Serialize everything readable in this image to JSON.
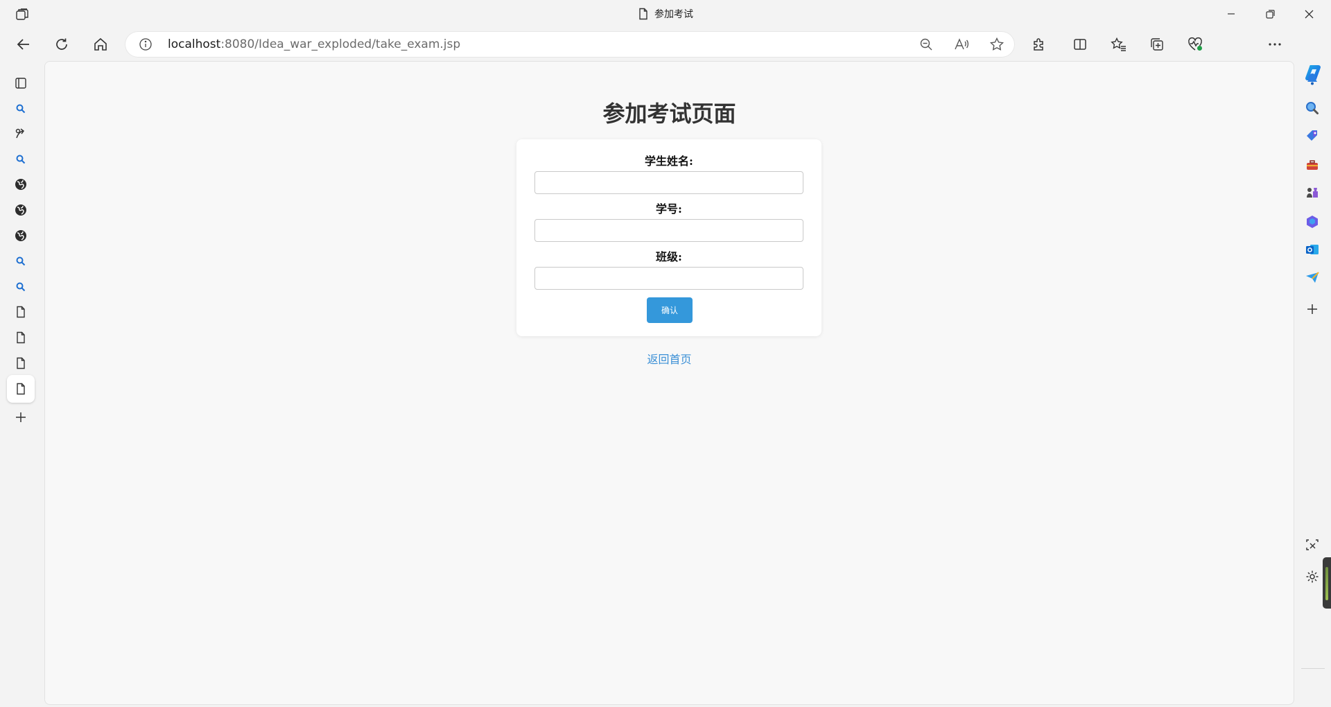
{
  "browser": {
    "tab_title": "参加考试",
    "url_host": "localhost",
    "url_rest": ":8080/Idea_war_exploded/take_exam.jsp",
    "icons": {
      "titlebar": [
        "tab-actions-icon",
        "page-icon",
        "minimize-icon",
        "restore-icon",
        "close-icon"
      ],
      "toolbar": [
        "back-icon",
        "refresh-icon",
        "home-icon",
        "info-icon",
        "zoom-out-icon",
        "read-aloud-icon",
        "favorite-star-icon",
        "extensions-icon",
        "split-screen-icon",
        "favorites-icon",
        "collections-icon",
        "browser-essentials-icon",
        "profile-avatar",
        "more-icon",
        "copilot-icon"
      ],
      "left_strip": [
        "tab-list-icon",
        "search-icon",
        "link-icon",
        "search-icon",
        "globe-icon",
        "globe-icon",
        "globe-icon",
        "search-icon",
        "search-icon",
        "page-icon",
        "page-icon",
        "page-icon",
        "page-icon",
        "new-tab-icon"
      ],
      "right_sidebar": [
        "bell-icon",
        "search-icon",
        "shopping-tag-icon",
        "toolbox-icon",
        "games-icon",
        "m365-icon",
        "outlook-icon",
        "send-icon",
        "add-icon",
        "screenshot-icon",
        "settings-icon"
      ]
    },
    "colors": {
      "accent": "#3498db",
      "link": "#3a8fd6",
      "chrome_bg": "#f3f3f3"
    }
  },
  "page": {
    "title": "参加考试页面",
    "form": {
      "name_label": "学生姓名:",
      "name_value": "",
      "id_label": "学号:",
      "id_value": "",
      "class_label": "班级:",
      "class_value": "",
      "submit_label": "确认"
    },
    "home_link": "返回首页"
  }
}
